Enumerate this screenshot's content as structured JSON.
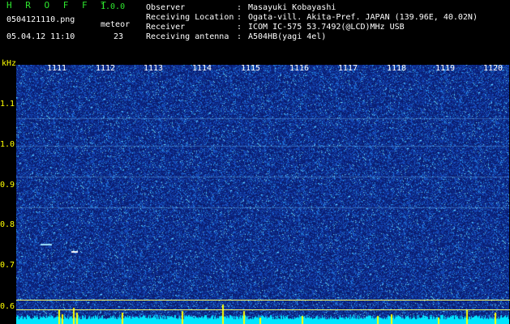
{
  "header": {
    "title": "H R O F F T",
    "version": "1.0.0",
    "filename": "0504121110.png",
    "datetime": "05.04.12 11:10",
    "meteor_label": "meteor",
    "meteor_count": "23"
  },
  "info": [
    {
      "key": "Observer",
      "value": "Masayuki Kobayashi"
    },
    {
      "key": "Receiving Location",
      "value": "Ogata-vill. Akita-Pref. JAPAN (139.96E, 40.02N)"
    },
    {
      "key": "Receiver",
      "value": "ICOM IC-575 53.7492(@LCD)MHz USB"
    },
    {
      "key": "Receiving antenna",
      "value": "A504HB(yagi 4el)"
    }
  ],
  "separator": ":",
  "axis": {
    "y_unit": "kHz",
    "y_ticks": [
      "1.1",
      "1.0",
      "0.9",
      "0.8",
      "0.7",
      "0.6"
    ],
    "x_ticks": [
      "1111",
      "1112",
      "1113",
      "1114",
      "1115",
      "1116",
      "1117",
      "1118",
      "1119",
      "1120"
    ]
  },
  "colors": {
    "background": "#000000",
    "plot": "#0b1f78",
    "header_green": "#2ee62e",
    "tick_yellow": "#ffff00",
    "noise_floor": "#00e5ff"
  }
}
